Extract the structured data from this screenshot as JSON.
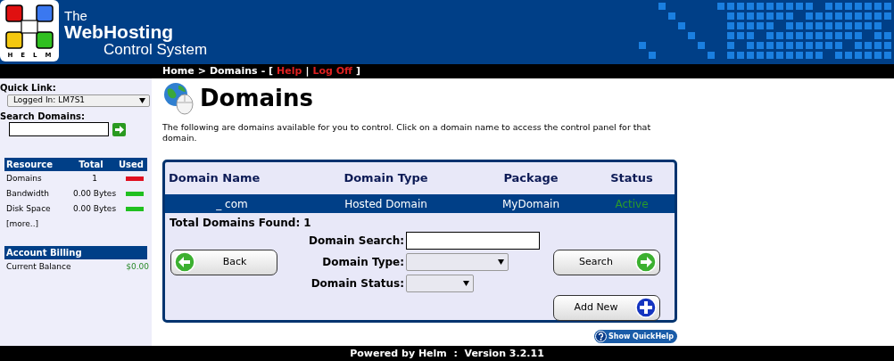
{
  "header": {
    "logo_letters": [
      "H",
      "E",
      "L",
      "M"
    ],
    "title_lines": [
      "The",
      "WebHosting",
      "Control System"
    ]
  },
  "breadcrumb": [
    {
      "text": "Home",
      "kind": "link"
    },
    {
      "text": ">",
      "kind": "sep"
    },
    {
      "text": "Domains",
      "kind": "link"
    },
    {
      "text": "- [",
      "kind": "sep"
    },
    {
      "text": "Help",
      "kind": "action"
    },
    {
      "text": "|",
      "kind": "sep"
    },
    {
      "text": "Log Off",
      "kind": "action"
    },
    {
      "text": "]",
      "kind": "sep"
    }
  ],
  "sidebar": {
    "quick_link": {
      "label": "Quick Link:",
      "value": "Logged In: LM7S1"
    },
    "search": {
      "label": "Search Domains:"
    },
    "resources": {
      "columns": [
        "Resource",
        "Total",
        "Used"
      ],
      "rows": [
        {
          "name": "Domains",
          "total": "1",
          "color": "#e01020"
        },
        {
          "name": "Bandwidth",
          "total": "0.00 Bytes",
          "color": "#20c020"
        },
        {
          "name": "Disk Space",
          "total": "0.00 Bytes",
          "color": "#20c020"
        }
      ],
      "more": "[more..]"
    },
    "billing": {
      "title": "Account Billing",
      "rows": [
        {
          "label": "Current Balance",
          "value": "$0.00"
        }
      ]
    }
  },
  "page": {
    "title": "Domains",
    "description": "The following are domains available for you to control. Click on a domain name to access the control panel for that domain."
  },
  "domains_table": {
    "columns": [
      "Domain Name",
      "Domain Type",
      "Package",
      "Status"
    ],
    "rows": [
      {
        "domain_name": "_ com",
        "domain_type": "Hosted Domain",
        "package": "MyDomain",
        "status": "Active"
      }
    ],
    "total": "Total Domains Found: 1"
  },
  "filters": [
    {
      "label": "Domain Search:",
      "kind": "text"
    },
    {
      "label": "Domain Type:",
      "kind": "select"
    },
    {
      "label": "Domain Status:",
      "kind": "select"
    }
  ],
  "back_button": {
    "label": "Back"
  },
  "search_button": {
    "label": "Search"
  },
  "add_button": {
    "label": "Add New"
  },
  "quickhelp": {
    "label": "Show QuickHelp"
  },
  "footer": "Powered by Helm  :  Version 3.2.11"
}
